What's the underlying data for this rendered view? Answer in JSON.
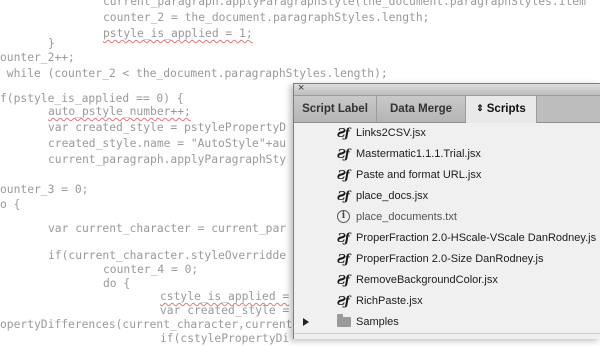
{
  "code_lines": [
    {
      "text": "current_paragraph.applyParagraphStyle(the_document.paragraphStyles.item",
      "err": false
    },
    {
      "text": "counter_2 = the_document.paragraphStyles.length;",
      "err": false
    },
    {
      "text": "pstyle_is_applied = 1;",
      "err": true
    },
    {
      "text": "}",
      "err": false
    },
    {
      "text": "ounter_2++;",
      "err": false
    },
    {
      "text": " while (counter_2 < the_document.paragraphStyles.length);",
      "err": false
    },
    {
      "text": "",
      "err": false
    },
    {
      "text": "f(pstyle_is_applied == 0) {",
      "err": false
    },
    {
      "text": "auto_pstyle_number++;",
      "err": true
    },
    {
      "text": "var created_style = pstylePropertyD",
      "err": false
    },
    {
      "text": "created_style.name = \"AutoStyle\"+au",
      "err": false
    },
    {
      "text": "current_paragraph.applyParagraphSty",
      "err": false
    },
    {
      "text": "",
      "err": false
    },
    {
      "text": "ounter_3 = 0;",
      "err": false
    },
    {
      "text": "o {",
      "err": false
    },
    {
      "text": "var current_character = current_par",
      "err": false
    },
    {
      "text": "",
      "err": false
    },
    {
      "text": "if(current_character.styleOverridde",
      "err": false
    },
    {
      "text": "counter_4 = 0;",
      "err": false
    },
    {
      "text": "do {",
      "err": false
    },
    {
      "text": "cstyle_is_applied =",
      "err": true
    },
    {
      "text": "var created_style =",
      "err": false
    },
    {
      "text": "opertyDifferences(current_character,current",
      "err": false
    },
    {
      "text": "if(cstylePropertyDi",
      "err": false
    }
  ],
  "panel": {
    "close_glyph": "×",
    "tabs": [
      {
        "label": "Script Label",
        "active": false
      },
      {
        "label": "Data Merge",
        "active": false
      },
      {
        "label": "Scripts",
        "active": true,
        "arrows": "⇕"
      }
    ],
    "items": [
      {
        "label": "Links2CSV.jsx",
        "icon": "javascript-file-icon",
        "type": "script"
      },
      {
        "label": "Mastermatic1.1.1.Trial.jsx",
        "icon": "javascript-file-icon",
        "type": "script"
      },
      {
        "label": "Paste and format URL.jsx",
        "icon": "javascript-file-icon",
        "type": "script"
      },
      {
        "label": "place_docs.jsx",
        "icon": "javascript-file-icon",
        "type": "script"
      },
      {
        "label": "place_documents.txt",
        "icon": "info-icon",
        "type": "doc"
      },
      {
        "label": "ProperFraction 2.0-HScale-VScale DanRodney.js",
        "icon": "javascript-file-icon",
        "type": "script"
      },
      {
        "label": "ProperFraction 2.0-Size DanRodney.js",
        "icon": "javascript-file-icon",
        "type": "script"
      },
      {
        "label": "RemoveBackgroundColor.jsx",
        "icon": "javascript-file-icon",
        "type": "script"
      },
      {
        "label": "RichPaste.jsx",
        "icon": "javascript-file-icon",
        "type": "script"
      },
      {
        "label": "Samples",
        "icon": "folder-icon",
        "type": "folder",
        "collapsed": true
      }
    ],
    "js_glyph": "Ƨƒ"
  },
  "colors": {
    "code_text": "#9a9a9a",
    "spell_underline": "#e07a7a",
    "panel_bg": "#d6d6d6",
    "active_tab": "#e9e9e9"
  }
}
